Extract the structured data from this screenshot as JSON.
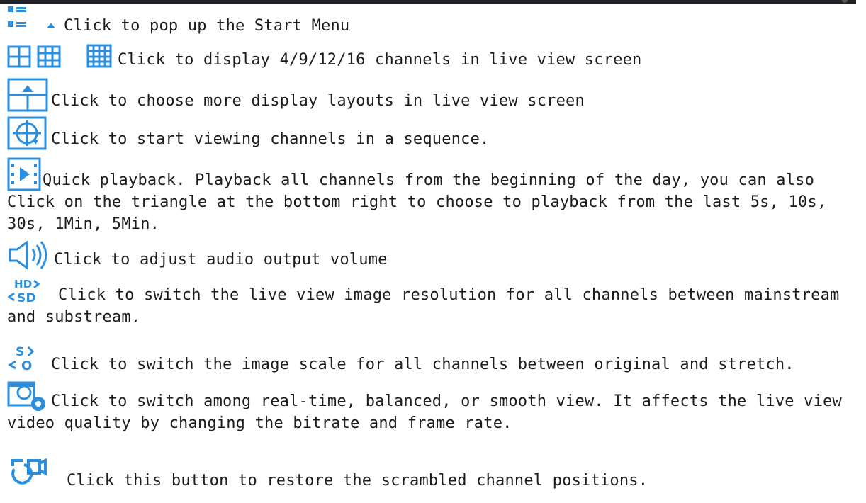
{
  "colors": {
    "icon": "#2b8fe0",
    "topbar": "#1f2126",
    "text": "#1c1c1c"
  },
  "entries": [
    {
      "icon": "start-menu-icon",
      "text": "Click to pop up the Start Menu"
    },
    {
      "icon": "multi-channel-grid-icons",
      "text": "Click to display 4/9/12/16 channels in live view screen"
    },
    {
      "icon": "layout-icon",
      "text": "Click to choose more display layouts in live view screen"
    },
    {
      "icon": "sequence-icon",
      "text": "Click to start viewing channels in a sequence."
    },
    {
      "icon": "quick-playback-icon",
      "text": "Quick playback. Playback all channels from the beginning of the day, you can also Click on the triangle at the bottom right to choose to playback from the last 5s, 10s, 30s, 1Min, 5Min."
    },
    {
      "icon": "volume-icon",
      "text": "Click to adjust audio output volume"
    },
    {
      "icon": "hd-sd-switch-icon",
      "text": "Click to switch the live view image resolution for all channels between mainstream and substream."
    },
    {
      "icon": "scale-switch-icon",
      "text": "Click to switch the image scale for all channels between original and stretch."
    },
    {
      "icon": "view-mode-icon",
      "text": "Click to switch among real-time, balanced, or smooth view. It affects the live view video quality by changing the bitrate and frame rate."
    },
    {
      "icon": "restore-positions-icon",
      "text": "Click this button to restore the scrambled channel positions."
    }
  ]
}
